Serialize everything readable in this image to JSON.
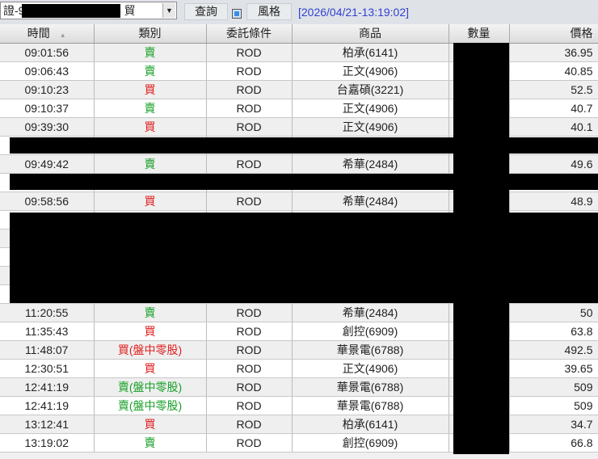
{
  "toolbar": {
    "account": "證-9",
    "account_suffix": "貿",
    "query_label": "查詢",
    "style_label": "風格",
    "timestamp": "[2026/04/21-13:19:02]"
  },
  "columns": [
    "時間",
    "類別",
    "委託條件",
    "商品",
    "數量",
    "價格"
  ],
  "rows": [
    {
      "time": "09:01:56",
      "type": "賣",
      "side": "sell",
      "cond": "ROD",
      "product": "柏承(6141)",
      "price": "36.95"
    },
    {
      "time": "09:06:43",
      "type": "賣",
      "side": "sell",
      "cond": "ROD",
      "product": "正文(4906)",
      "price": "40.85"
    },
    {
      "time": "09:10:23",
      "type": "買",
      "side": "buy",
      "cond": "ROD",
      "product": "台嘉碩(3221)",
      "price": "52.5"
    },
    {
      "time": "09:10:37",
      "type": "賣",
      "side": "sell",
      "cond": "ROD",
      "product": "正文(4906)",
      "price": "40.7"
    },
    {
      "time": "09:39:30",
      "type": "買",
      "side": "buy",
      "cond": "ROD",
      "product": "正文(4906)",
      "price": "40.1"
    },
    {
      "redacted": true
    },
    {
      "time": "09:49:42",
      "type": "賣",
      "side": "sell",
      "cond": "ROD",
      "product": "希華(2484)",
      "price": "49.6"
    },
    {
      "redacted": true
    },
    {
      "time": "09:58:56",
      "type": "買",
      "side": "buy",
      "cond": "ROD",
      "product": "希華(2484)",
      "price": "48.9"
    },
    {
      "redacted": true
    },
    {
      "redacted": true
    },
    {
      "redacted": true
    },
    {
      "redacted": true
    },
    {
      "redacted": true
    },
    {
      "time": "11:20:55",
      "type": "賣",
      "side": "sell",
      "cond": "ROD",
      "product": "希華(2484)",
      "price": "50"
    },
    {
      "time": "11:35:43",
      "type": "買",
      "side": "buy",
      "cond": "ROD",
      "product": "創控(6909)",
      "price": "63.8"
    },
    {
      "time": "11:48:07",
      "type": "買(盤中零股)",
      "side": "buy",
      "cond": "ROD",
      "product": "華景電(6788)",
      "price": "492.5"
    },
    {
      "time": "12:30:51",
      "type": "買",
      "side": "buy",
      "cond": "ROD",
      "product": "正文(4906)",
      "price": "39.65"
    },
    {
      "time": "12:41:19",
      "type": "賣(盤中零股)",
      "side": "sell",
      "cond": "ROD",
      "product": "華景電(6788)",
      "price": "509"
    },
    {
      "time": "12:41:19",
      "type": "賣(盤中零股)",
      "side": "sell",
      "cond": "ROD",
      "product": "華景電(6788)",
      "price": "509"
    },
    {
      "time": "13:12:41",
      "type": "買",
      "side": "buy",
      "cond": "ROD",
      "product": "柏承(6141)",
      "price": "34.7"
    },
    {
      "time": "13:19:02",
      "type": "賣",
      "side": "sell",
      "cond": "ROD",
      "product": "創控(6909)",
      "price": "66.8"
    }
  ]
}
